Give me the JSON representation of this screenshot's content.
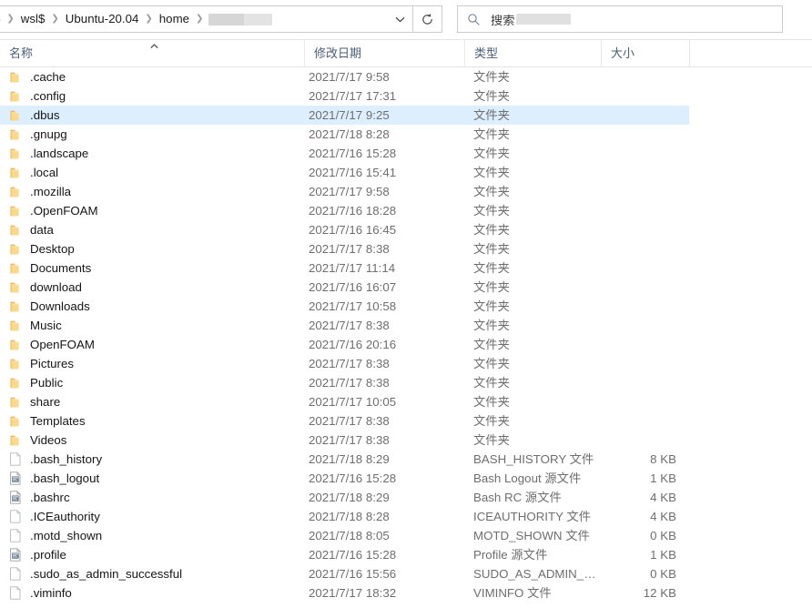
{
  "addressbar": {
    "crumbs": [
      {
        "label": "$",
        "clipped": true
      },
      {
        "label": "wsl$",
        "clipped": false
      },
      {
        "label": "Ubuntu-20.04",
        "clipped": false
      },
      {
        "label": "home",
        "clipped": false
      }
    ],
    "final_crumb_redacted": true,
    "dropdown_icon": "chevron-down-icon",
    "refresh_icon": "refresh-icon",
    "refresh_glyph": "↻"
  },
  "search": {
    "icon": "search-icon",
    "placeholder_prefix": "搜索",
    "redacted": true
  },
  "columns": {
    "name": "名称",
    "date": "修改日期",
    "type": "类型",
    "size": "大小",
    "sort_column": "name",
    "sort_direction": "ascending",
    "sort_icon": "caret-up-icon"
  },
  "colors": {
    "selection": "#ddeeff",
    "folder_icon": "#f6d07a",
    "header_text": "#4a5d78",
    "secondary_text": "#6e6e6e"
  },
  "rows": [
    {
      "name": ".cache",
      "date": "2021/7/17 9:58",
      "type": "文件夹",
      "size": "",
      "icon": "folder-icon",
      "selected": false
    },
    {
      "name": ".config",
      "date": "2021/7/17 17:31",
      "type": "文件夹",
      "size": "",
      "icon": "folder-icon",
      "selected": false
    },
    {
      "name": ".dbus",
      "date": "2021/7/17 9:25",
      "type": "文件夹",
      "size": "",
      "icon": "folder-icon",
      "selected": true
    },
    {
      "name": ".gnupg",
      "date": "2021/7/18 8:28",
      "type": "文件夹",
      "size": "",
      "icon": "folder-icon",
      "selected": false
    },
    {
      "name": ".landscape",
      "date": "2021/7/16 15:28",
      "type": "文件夹",
      "size": "",
      "icon": "folder-icon",
      "selected": false
    },
    {
      "name": ".local",
      "date": "2021/7/16 15:41",
      "type": "文件夹",
      "size": "",
      "icon": "folder-icon",
      "selected": false
    },
    {
      "name": ".mozilla",
      "date": "2021/7/17 9:58",
      "type": "文件夹",
      "size": "",
      "icon": "folder-icon",
      "selected": false
    },
    {
      "name": ".OpenFOAM",
      "date": "2021/7/16 18:28",
      "type": "文件夹",
      "size": "",
      "icon": "folder-icon",
      "selected": false
    },
    {
      "name": "data",
      "date": "2021/7/16 16:45",
      "type": "文件夹",
      "size": "",
      "icon": "folder-icon",
      "selected": false
    },
    {
      "name": "Desktop",
      "date": "2021/7/17 8:38",
      "type": "文件夹",
      "size": "",
      "icon": "folder-icon",
      "selected": false
    },
    {
      "name": "Documents",
      "date": "2021/7/17 11:14",
      "type": "文件夹",
      "size": "",
      "icon": "folder-icon",
      "selected": false
    },
    {
      "name": "download",
      "date": "2021/7/16 16:07",
      "type": "文件夹",
      "size": "",
      "icon": "folder-icon",
      "selected": false
    },
    {
      "name": "Downloads",
      "date": "2021/7/17 10:58",
      "type": "文件夹",
      "size": "",
      "icon": "folder-icon",
      "selected": false
    },
    {
      "name": "Music",
      "date": "2021/7/17 8:38",
      "type": "文件夹",
      "size": "",
      "icon": "folder-icon",
      "selected": false
    },
    {
      "name": "OpenFOAM",
      "date": "2021/7/16 20:16",
      "type": "文件夹",
      "size": "",
      "icon": "folder-icon",
      "selected": false
    },
    {
      "name": "Pictures",
      "date": "2021/7/17 8:38",
      "type": "文件夹",
      "size": "",
      "icon": "folder-icon",
      "selected": false
    },
    {
      "name": "Public",
      "date": "2021/7/17 8:38",
      "type": "文件夹",
      "size": "",
      "icon": "folder-icon",
      "selected": false
    },
    {
      "name": "share",
      "date": "2021/7/17 10:05",
      "type": "文件夹",
      "size": "",
      "icon": "folder-icon",
      "selected": false
    },
    {
      "name": "Templates",
      "date": "2021/7/17 8:38",
      "type": "文件夹",
      "size": "",
      "icon": "folder-icon",
      "selected": false
    },
    {
      "name": "Videos",
      "date": "2021/7/17 8:38",
      "type": "文件夹",
      "size": "",
      "icon": "folder-icon",
      "selected": false
    },
    {
      "name": ".bash_history",
      "date": "2021/7/18 8:29",
      "type": "BASH_HISTORY 文件",
      "size": "8 KB",
      "icon": "generic-file-icon",
      "selected": false
    },
    {
      "name": ".bash_logout",
      "date": "2021/7/16 15:28",
      "type": "Bash Logout 源文件",
      "size": "1 KB",
      "icon": "source-file-icon",
      "selected": false
    },
    {
      "name": ".bashrc",
      "date": "2021/7/18 8:29",
      "type": "Bash RC 源文件",
      "size": "4 KB",
      "icon": "source-file-icon",
      "selected": false
    },
    {
      "name": ".ICEauthority",
      "date": "2021/7/18 8:28",
      "type": "ICEAUTHORITY 文件",
      "size": "4 KB",
      "icon": "generic-file-icon",
      "selected": false
    },
    {
      "name": ".motd_shown",
      "date": "2021/7/18 8:05",
      "type": "MOTD_SHOWN 文件",
      "size": "0 KB",
      "icon": "generic-file-icon",
      "selected": false
    },
    {
      "name": ".profile",
      "date": "2021/7/16 15:28",
      "type": "Profile 源文件",
      "size": "1 KB",
      "icon": "source-file-icon",
      "selected": false
    },
    {
      "name": ".sudo_as_admin_successful",
      "date": "2021/7/16 15:56",
      "type": "SUDO_AS_ADMIN_SU...",
      "size": "0 KB",
      "icon": "generic-file-icon",
      "selected": false
    },
    {
      "name": ".viminfo",
      "date": "2021/7/17 18:32",
      "type": "VIMINFO 文件",
      "size": "12 KB",
      "icon": "generic-file-icon",
      "selected": false
    }
  ]
}
